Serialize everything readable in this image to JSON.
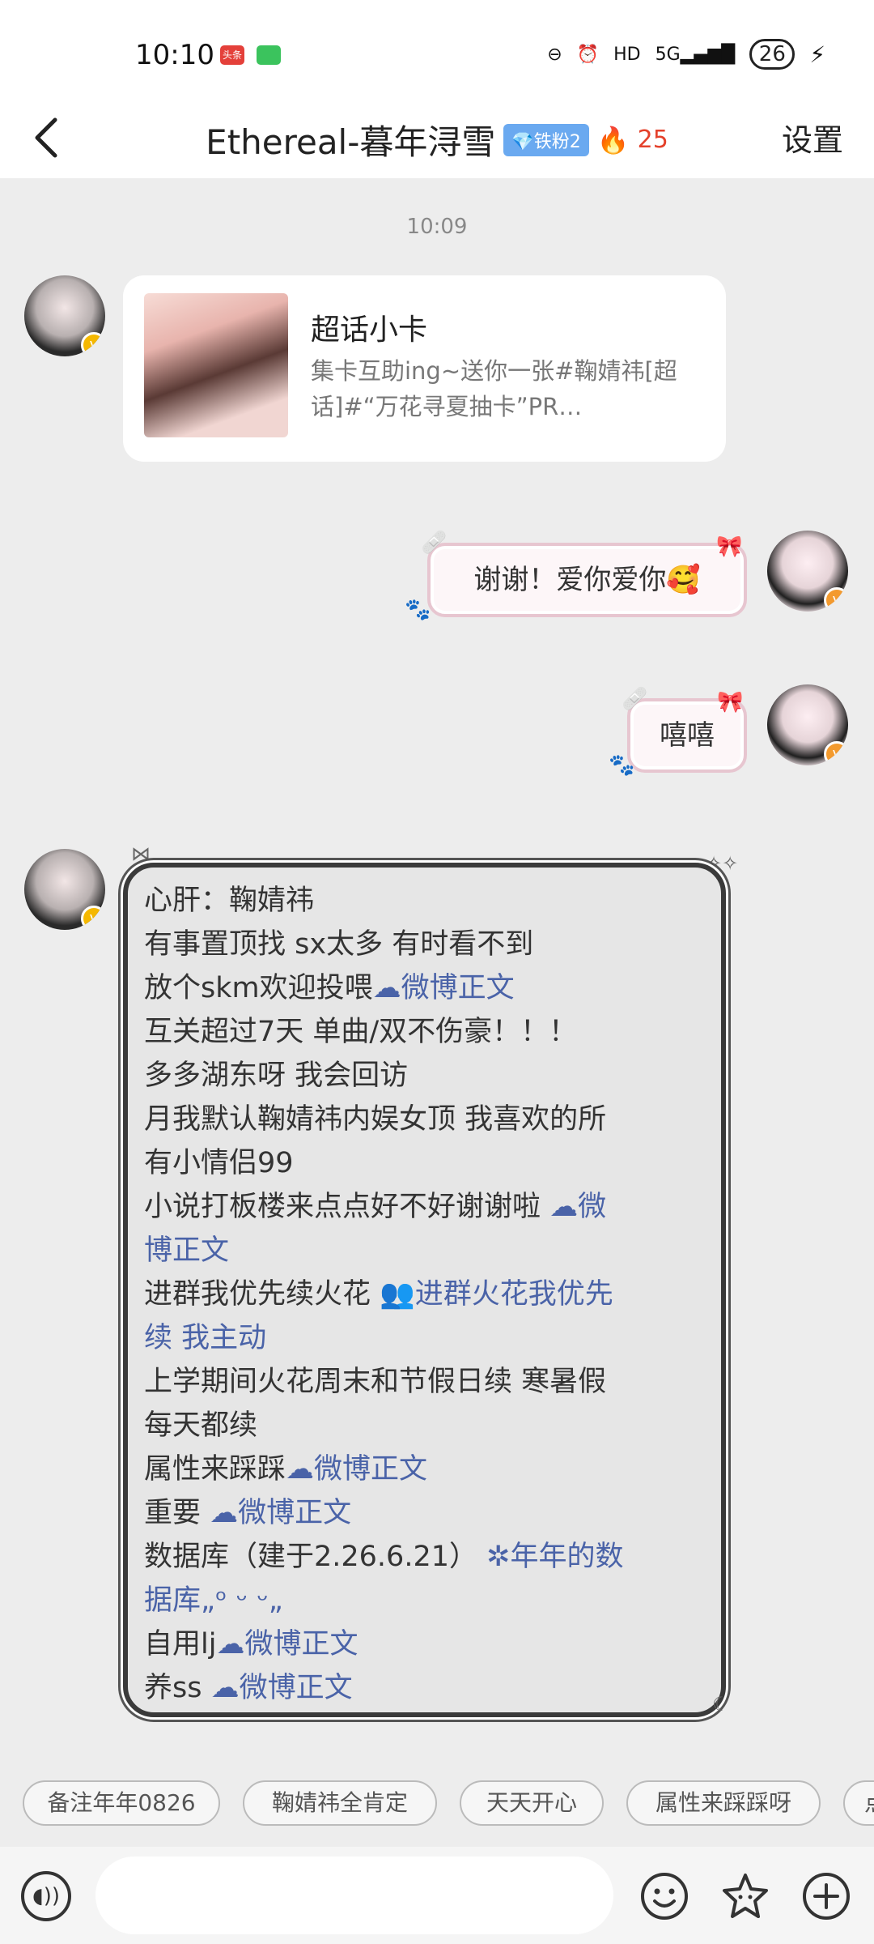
{
  "status": {
    "time": "10:10",
    "app_badge": "头条",
    "battery": "26"
  },
  "header": {
    "title": "Ethereal-暮年浔雪",
    "fan_badge": "铁粉2",
    "fire_count": "25",
    "settings_label": "设置"
  },
  "chat": {
    "timestamp": "10:09",
    "card": {
      "title": "超话小卡",
      "description": "集卡互助ing~送你一张#鞠婧祎[超话]#“万花寻夏抽卡”PR…"
    },
    "messages": [
      {
        "text": "谢谢！爱你爱你🥰"
      },
      {
        "text": "嘻嘻"
      }
    ],
    "profile": {
      "lines": [
        {
          "text": "心肝：鞠婧祎",
          "link": ""
        },
        {
          "text": "有事置顶找 sx太多 有时看不到",
          "link": ""
        },
        {
          "text": "放个skm欢迎投喂",
          "link": "☁微博正文"
        },
        {
          "text": "互关超过7天 单曲/双不伤豪！！！",
          "link": ""
        },
        {
          "text": "多多湖东呀 我会回访",
          "link": ""
        },
        {
          "text": "月我默认鞠婧祎内娱女顶 我喜欢的所",
          "link": ""
        },
        {
          "text": "有小情侣99",
          "link": ""
        },
        {
          "text": "小说打板楼来点点好不好谢谢啦 ",
          "link": "☁微"
        },
        {
          "text": "",
          "link": "博正文"
        },
        {
          "text": "进群我优先续火花 ",
          "link": "👥进群火花我优先"
        },
        {
          "text": "",
          "link": "续 我主动"
        },
        {
          "text": "上学期间火花周末和节假日续 寒暑假",
          "link": ""
        },
        {
          "text": "每天都续",
          "link": ""
        },
        {
          "text": "属性来踩踩",
          "link": "☁微博正文"
        },
        {
          "text": "重要 ",
          "link": "☁微博正文"
        },
        {
          "text": "数据库（建于2.26.6.21） ",
          "link": "✲年年的数"
        },
        {
          "text": "",
          "link": "据库„ᵒ ᵕ ᵕ„"
        },
        {
          "text": "自用lj",
          "link": "☁微博正文"
        },
        {
          "text": "养ss ",
          "link": "☁微博正文"
        }
      ]
    }
  },
  "quick_replies": [
    "备注年年0826",
    "鞠婧祎全肯定",
    "天天开心",
    "属性来踩踩呀",
    "点"
  ],
  "input": {
    "placeholder": ""
  },
  "colors": {
    "link": "#4a63a8",
    "fire": "#e4412b",
    "fan_badge": "#6aa9f0"
  },
  "icons": [
    "back-icon",
    "fire-icon",
    "voice-icon",
    "emoji-icon",
    "sticker-icon",
    "add-icon"
  ]
}
